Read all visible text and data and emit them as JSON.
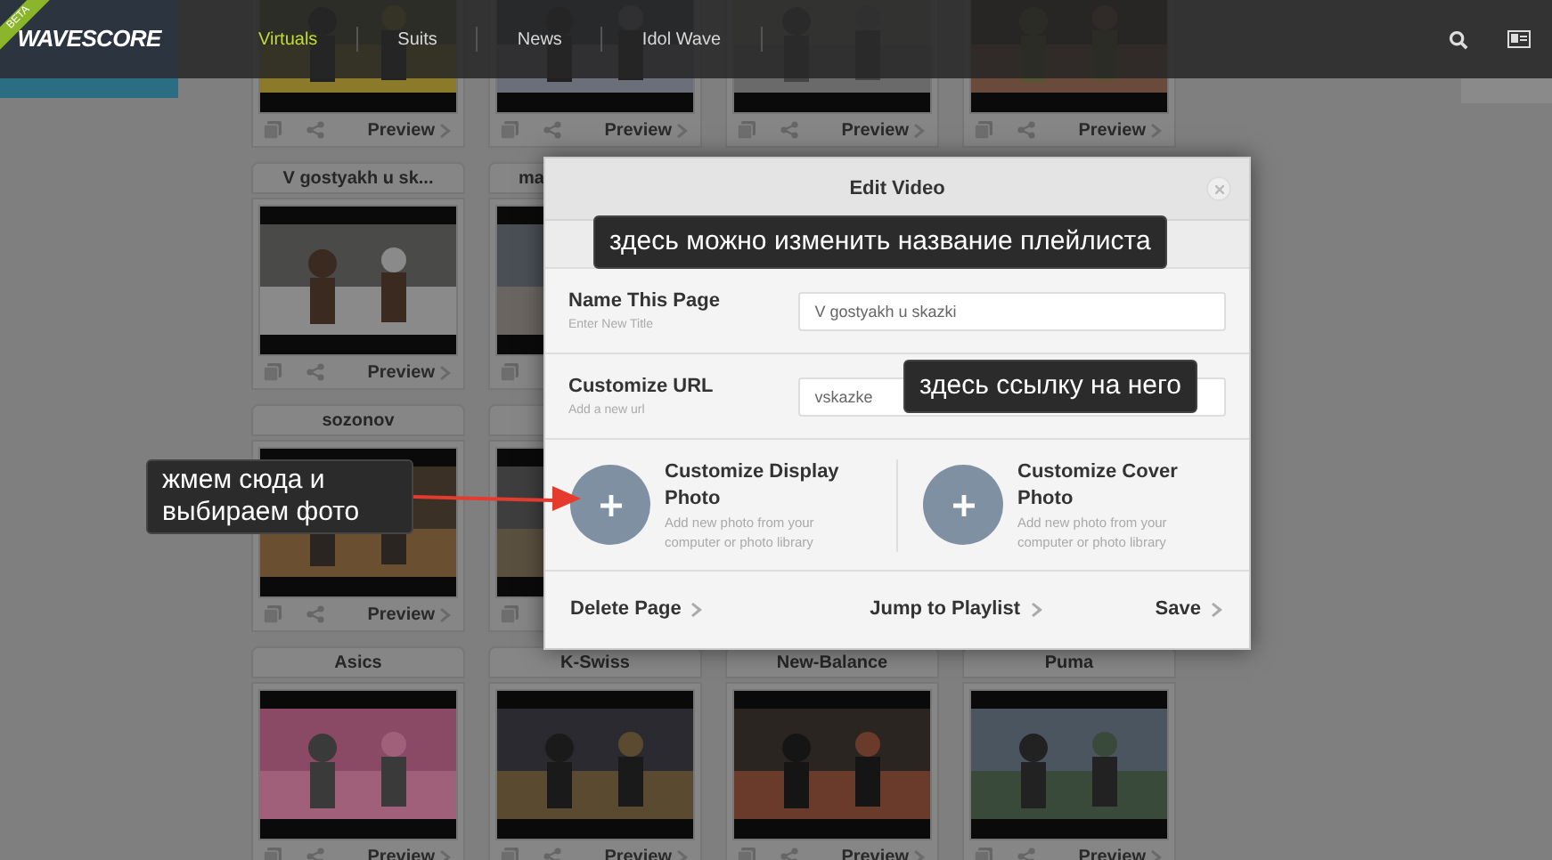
{
  "header": {
    "logo": "WAVESCORE",
    "badge": "BETA",
    "nav": [
      {
        "label": "Virtuals",
        "selected": true
      },
      {
        "label": "Suits",
        "selected": false
      },
      {
        "label": "News",
        "selected": false
      },
      {
        "label": "Idol Wave",
        "selected": false
      }
    ]
  },
  "cards": [
    {
      "kind": "picture",
      "preview": "Preview"
    },
    {
      "kind": "picture",
      "preview": "Preview"
    },
    {
      "kind": "picture",
      "preview": "Preview"
    },
    {
      "kind": "picture",
      "preview": "Preview"
    },
    {
      "kind": "picture",
      "title": "V gostyakh u sk...",
      "preview": "Preview"
    },
    {
      "kind": "picture",
      "title": "ma"
    },
    {
      "kind": "covered"
    },
    {
      "kind": "covered"
    },
    {
      "kind": "picture",
      "title": "sozonov",
      "preview": "Preview"
    },
    {
      "kind": "picture"
    },
    {
      "kind": "covered"
    },
    {
      "kind": "covered"
    },
    {
      "kind": "picture",
      "title": "Asics",
      "preview": "Preview"
    },
    {
      "kind": "picture",
      "title": "K-Swiss",
      "preview": "Preview"
    },
    {
      "kind": "picture",
      "title": "New-Balance",
      "preview": "Preview"
    },
    {
      "kind": "picture",
      "title": "Puma",
      "preview": "Preview"
    }
  ],
  "modal": {
    "title": "Edit Video",
    "fields": [
      {
        "label": "Name This Page",
        "hint": "Enter New Title",
        "value": "V gostyakh u skazki"
      },
      {
        "label": "Customize URL",
        "hint": "Add a new url",
        "value": "vskazke"
      }
    ],
    "photos": [
      {
        "title": "Customize Display Photo",
        "description": "Add new photo from your computer or photo library"
      },
      {
        "title": "Customize Cover Photo",
        "description": "Add new photo from your computer or photo library"
      }
    ],
    "actions": [
      "Delete Page",
      "Jump to Playlist",
      "Save"
    ]
  },
  "annotations": [
    {
      "text": "здесь можно изменить название плейлиста"
    },
    {
      "text": "здесь ссылку на него"
    },
    {
      "text": "жмем сюда и выбираем фото"
    }
  ]
}
